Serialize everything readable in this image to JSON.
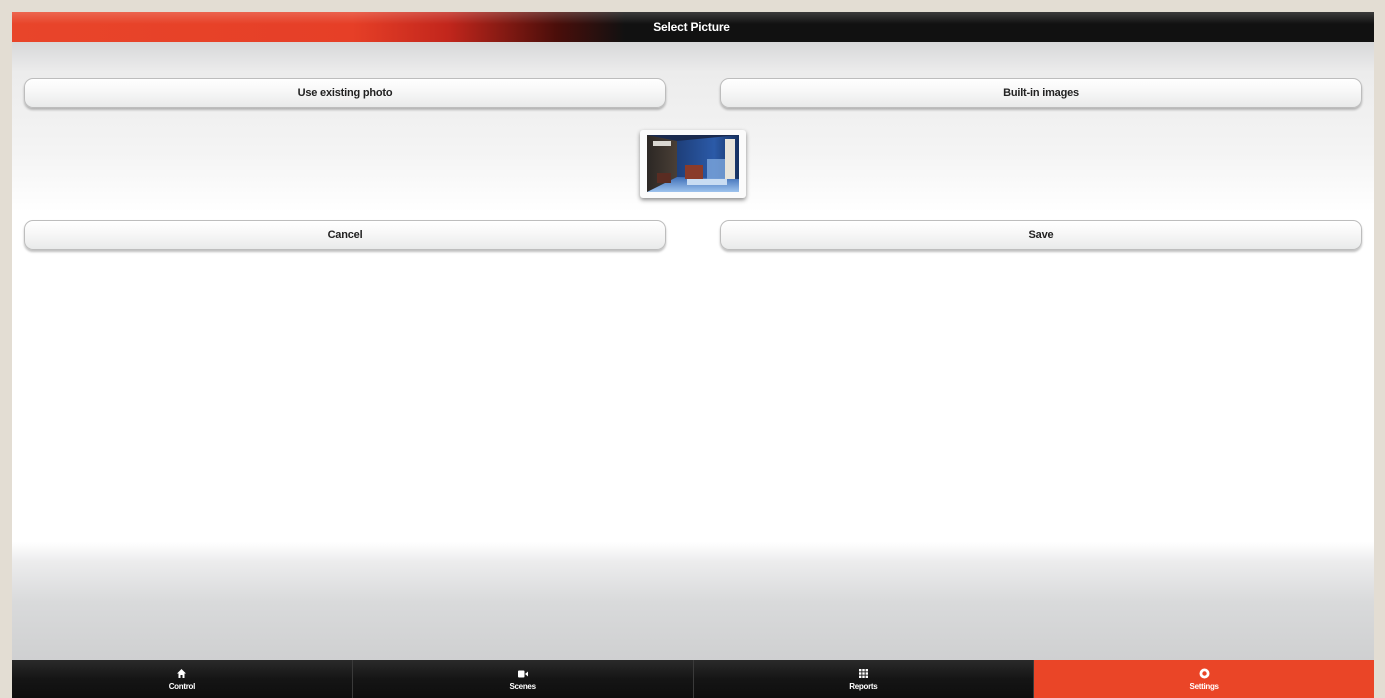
{
  "window": {
    "title": "Select Picture"
  },
  "actions": {
    "use_existing_label": "Use existing photo",
    "built_in_label": "Built-in images",
    "cancel_label": "Cancel",
    "save_label": "Save"
  },
  "preview": {
    "icon": "room-photo-thumbnail"
  },
  "tabbar": {
    "items": [
      {
        "label": "Control",
        "icon": "home-icon",
        "active": false
      },
      {
        "label": "Scenes",
        "icon": "camera-icon",
        "active": false
      },
      {
        "label": "Reports",
        "icon": "grid-icon",
        "active": false
      },
      {
        "label": "Settings",
        "icon": "gear-icon",
        "active": true
      }
    ]
  },
  "colors": {
    "accent": "#ea4527",
    "bar_dark": "#141414"
  }
}
